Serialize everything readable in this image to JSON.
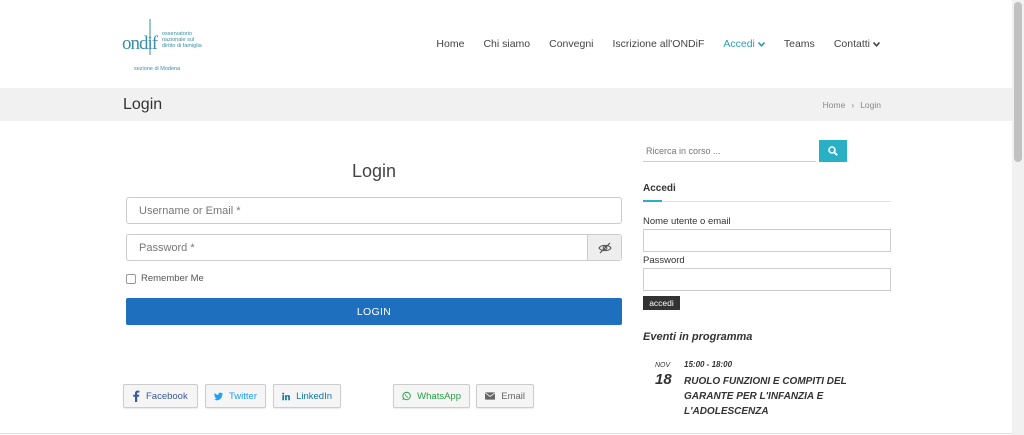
{
  "logo": {
    "brand": "ondif",
    "subtitle": "osservatorio nazionale sul diritto di famiglia",
    "section": "sezione di Modena"
  },
  "nav": {
    "home": "Home",
    "chi_siamo": "Chi siamo",
    "convegni": "Convegni",
    "iscrizione": "Iscrizione all'ONDiF",
    "accedi": "Accedi",
    "teams": "Teams",
    "contatti": "Contatti"
  },
  "page": {
    "title": "Login",
    "breadcrumb_home": "Home",
    "breadcrumb_sep": "›",
    "breadcrumb_current": "Login"
  },
  "login_form": {
    "title": "Login",
    "username_placeholder": "Username or Email *",
    "password_placeholder": "Password *",
    "remember_label": "Remember Me",
    "submit_label": "LOGIN"
  },
  "share": {
    "facebook": "Facebook",
    "twitter": "Twitter",
    "linkedin": "LinkedIn",
    "whatsapp": "WhatsApp",
    "email": "Email"
  },
  "sidebar": {
    "search_placeholder": "Ricerca in corso ...",
    "login_heading": "Accedi",
    "username_label": "Nome utente o email",
    "password_label": "Password",
    "submit_label": "accedi",
    "events_heading": "Eventi in programma",
    "event": {
      "month": "NOV",
      "day": "18",
      "time": "15:00 - 18:00",
      "title": "RUOLO FUNZIONI E COMPITI DEL GARANTE PER L'INFANZIA E L'ADOLESCENZA"
    }
  },
  "colors": {
    "accent": "#2ab0c5",
    "primary_button": "#1f6fbf",
    "nav_active": "#2a9db3"
  }
}
